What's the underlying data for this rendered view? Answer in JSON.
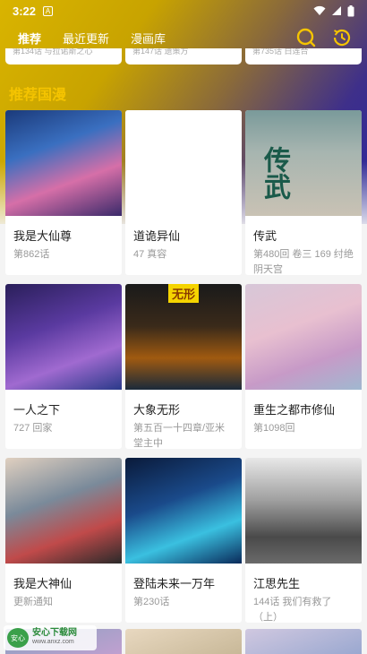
{
  "status_bar": {
    "time": "3:22",
    "notification_glyph": "A"
  },
  "header": {
    "tabs": [
      {
        "label": "推荐",
        "active": true
      },
      {
        "label": "最近更新",
        "active": false
      },
      {
        "label": "漫画库",
        "active": false
      }
    ],
    "icons": [
      "search-icon",
      "history-icon"
    ]
  },
  "previous_row": [
    "第134话 与拉诺斯之心",
    "第147话 遗策方",
    "第735话 白莲合"
  ],
  "section": {
    "title": "推荐国漫"
  },
  "comics": [
    {
      "title": "我是大仙尊",
      "subtitle": "第862话"
    },
    {
      "title": "道诡异仙",
      "subtitle": "47 真容"
    },
    {
      "title": "传武",
      "subtitle": "第480回 卷三 169 纣绝阴天宫"
    },
    {
      "title": "一人之下",
      "subtitle": "727 回家"
    },
    {
      "title": "大象无形",
      "subtitle": "第五百一十四章/亚米堂主中"
    },
    {
      "title": "重生之都市修仙",
      "subtitle": "第1098回"
    },
    {
      "title": "我是大神仙",
      "subtitle": "更新通知"
    },
    {
      "title": "登陆未来一万年",
      "subtitle": "第230话"
    },
    {
      "title": "江思先生",
      "subtitle": "144话 我们有救了（上）"
    }
  ],
  "cover_labels": {
    "chuanwu": "传武",
    "daxiang_badge": "无形"
  },
  "watermark": {
    "name": "安心下载网",
    "url": "www.anxz.com",
    "logo_text": "安心"
  },
  "colors": {
    "accent": "#f5c400",
    "header_gradient_start": "#d9b400",
    "header_gradient_end": "#2a2a9e"
  }
}
